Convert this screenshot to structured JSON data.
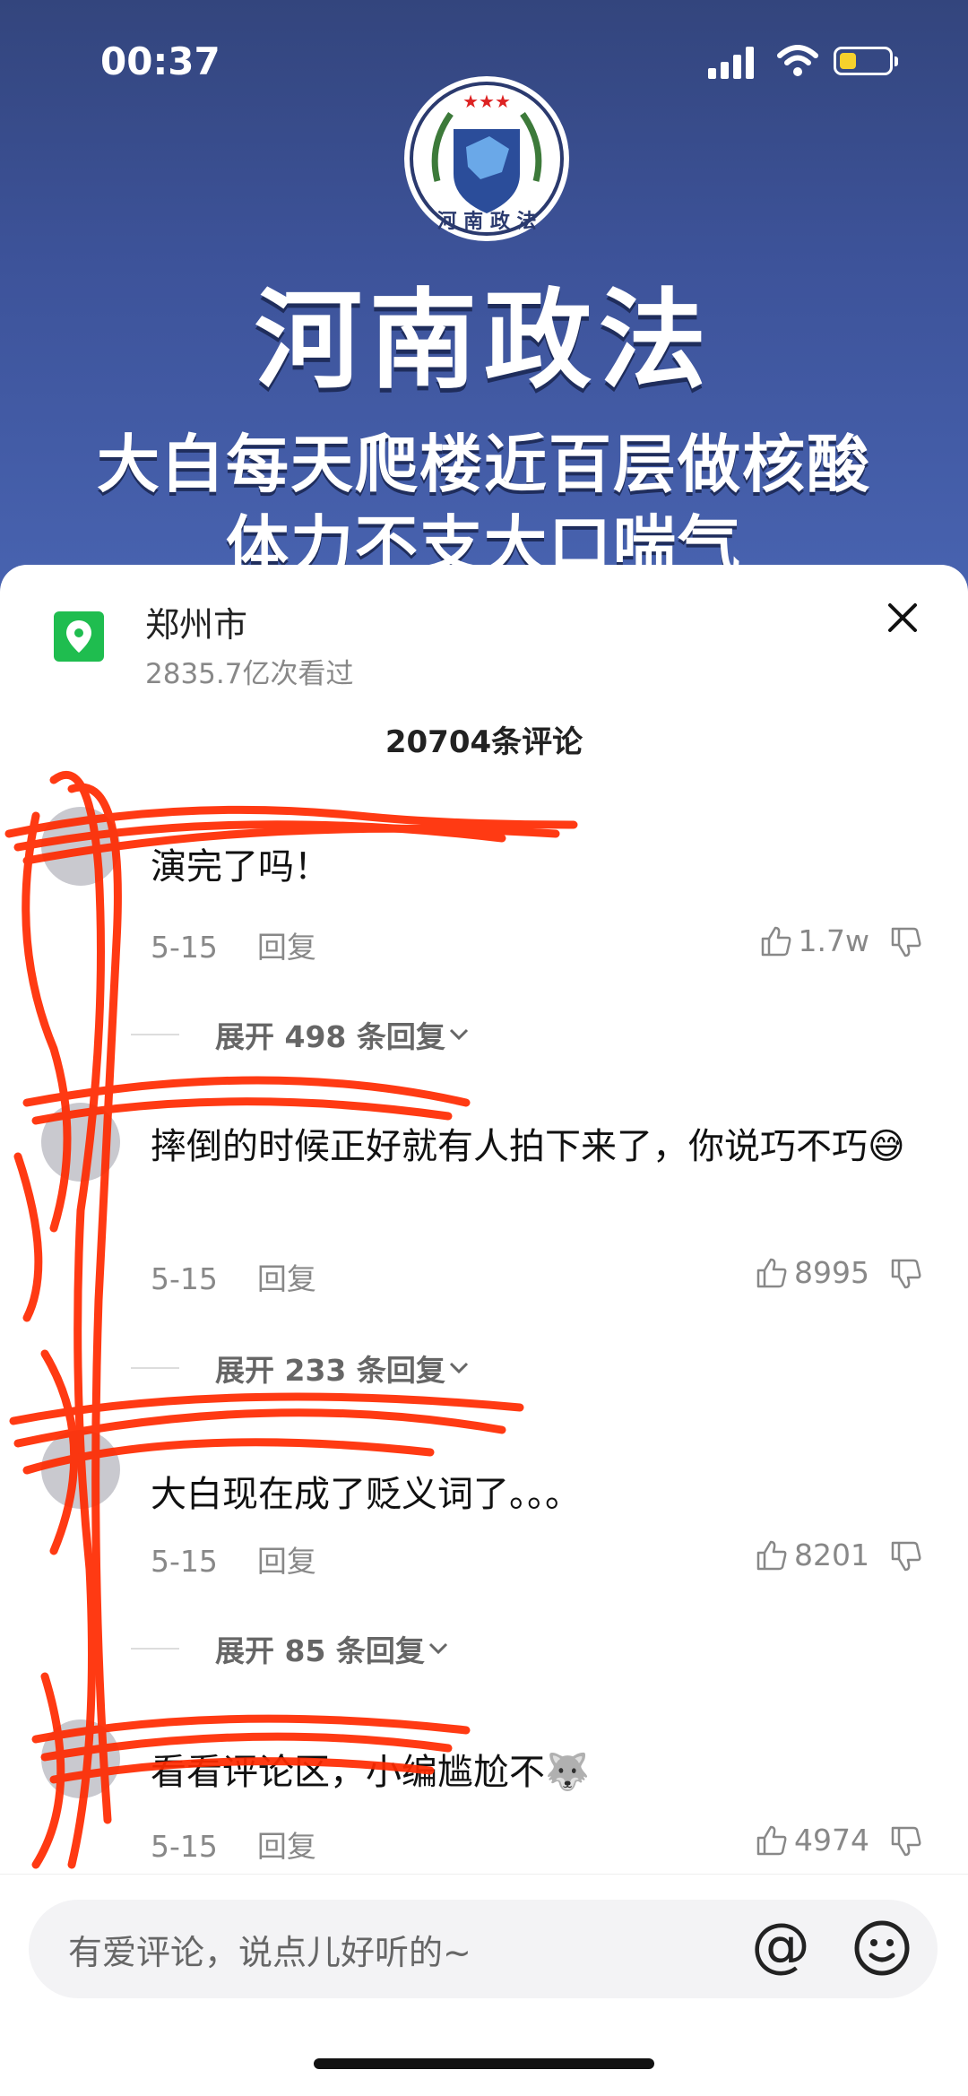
{
  "status": {
    "time": "00:37"
  },
  "video": {
    "emblem_text": "河南政法",
    "title": "河南政法",
    "subtitle_line1": "大白每天爬楼近百层做核酸",
    "subtitle_line2": "体力不支大口喘气"
  },
  "location": {
    "name": "郑州市",
    "views": "2835.7亿次看过"
  },
  "comments_count": "20704条评论",
  "comments": [
    {
      "user": "",
      "text": "演完了吗！",
      "date": "5-15",
      "reply": "回复",
      "likes": "1.7w",
      "expand": "展开 498 条回复"
    },
    {
      "user": "",
      "text": "摔倒的时候正好就有人拍下来了，你说巧不巧😅",
      "date": "5-15",
      "reply": "回复",
      "likes": "8995",
      "expand": "展开 233 条回复"
    },
    {
      "user": "",
      "text": "大白现在成了贬义词了。。。",
      "date": "5-15",
      "reply": "回复",
      "likes": "8201",
      "expand": "展开 85 条回复"
    },
    {
      "user": "",
      "text": "看看评论区，小编尴尬不🐺",
      "date": "5-15",
      "reply": "回复",
      "likes": "4974",
      "expand": ""
    }
  ],
  "input": {
    "placeholder": "有爱评论，说点儿好听的~",
    "at_symbol": "@"
  },
  "colors": {
    "video_bg": "#3d539a",
    "location_icon": "#1fbd4f",
    "redaction": "#ff2a00"
  },
  "icons": [
    "wifi-icon",
    "battery-icon",
    "location-pin-icon",
    "close-icon",
    "thumbs-up-icon",
    "thumbs-down-icon",
    "at-icon",
    "emoji-icon",
    "chevron-down-icon"
  ]
}
